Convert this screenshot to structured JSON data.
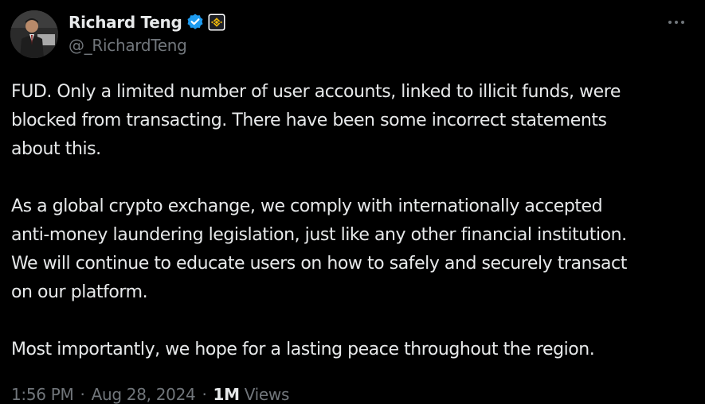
{
  "author": {
    "display_name": "Richard Teng",
    "handle": "@_RichardTeng",
    "avatar_icon": "profile-photo",
    "verified_icon": "verified-badge-icon",
    "affiliate_icon": "binance-logo-icon"
  },
  "tweet": {
    "paragraphs": [
      "FUD. Only a limited number of user accounts, linked to illicit funds, were\nblocked from transacting. There have been some incorrect statements\nabout this.",
      "As a global crypto exchange, we comply with internationally accepted\nanti-money laundering legislation, just like any other financial institution.\nWe will continue to educate users on how to safely and securely transact\non our platform.",
      "Most importantly, we hope for a lasting peace throughout the region."
    ],
    "time": "1:56 PM",
    "date": "Aug 28, 2024",
    "separator": "·",
    "views_count": "1M",
    "views_label": "Views"
  },
  "actions": {
    "more_icon": "more-horizontal-icon"
  },
  "colors": {
    "background": "#000000",
    "text": "#e7e9ea",
    "secondary": "#71767b",
    "verified": "#1d9bf0",
    "binance": "#f0b90b"
  }
}
